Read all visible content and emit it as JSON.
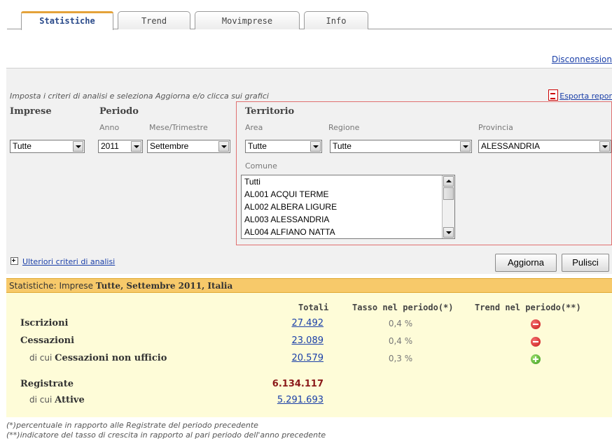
{
  "tabs": [
    {
      "label": "Statistiche",
      "active": true
    },
    {
      "label": "Trend",
      "active": false
    },
    {
      "label": "Movimprese",
      "active": false
    },
    {
      "label": "Info",
      "active": false
    }
  ],
  "top": {
    "disconnect": "Disconnession"
  },
  "criteria": {
    "hint": "Imposta i criteri di analisi e seleziona Aggiorna e/o clicca sui grafici",
    "export": "Esporta repor",
    "imprese": {
      "label": "Imprese",
      "value": "Tutte"
    },
    "periodo": {
      "label": "Periodo",
      "anno_label": "Anno",
      "anno_value": "2011",
      "mese_label": "Mese/Trimestre",
      "mese_value": "Settembre"
    },
    "territorio": {
      "label": "Territorio",
      "area_label": "Area",
      "area_value": "Tutte",
      "regione_label": "Regione",
      "regione_value": "Tutte",
      "provincia_label": "Provincia",
      "provincia_value": "ALESSANDRIA",
      "comune_label": "Comune",
      "comuni": [
        "Tutti",
        "AL001 ACQUI TERME",
        "AL002 ALBERA LIGURE",
        "AL003 ALESSANDRIA",
        "AL004 ALFIANO NATTA"
      ]
    },
    "more": "Ulteriori criteri di analisi",
    "aggiorna": "Aggiorna",
    "pulisci": "Pulisci"
  },
  "stats": {
    "header_prefix": "Statistiche: Imprese ",
    "header_bold": "Tutte, Settembre 2011, Italia",
    "col_totali": "Totali",
    "col_tasso": "Tasso nel periodo(*)",
    "col_trend": "Trend nel periodo(**)",
    "rows": [
      {
        "label": "Iscrizioni",
        "total": "27.492",
        "rate": "0,4 %",
        "trend": "down"
      },
      {
        "label": "Cessazioni",
        "total": "23.089",
        "rate": "0,4 %",
        "trend": "down"
      },
      {
        "prefix": "di cui ",
        "label": "Cessazioni non ufficio",
        "total": "20.579",
        "rate": "0,3 %",
        "trend": "up"
      }
    ],
    "registrate": {
      "label": "Registrate",
      "total": "6.134.117"
    },
    "attive": {
      "prefix": "di cui ",
      "label": "Attive",
      "total": "5.291.693"
    },
    "note1": "(*)percentuale in rapporto alle Registrate del periodo precedente",
    "note2": "(**)indicatore del tasso di crescita in rapporto al pari periodo dell'anno precedente"
  },
  "colors": {
    "tab_accent": "#e4a23a",
    "header_bar": "#f7c96a",
    "body_bg": "#fefcd8",
    "territory_border": "#e07070",
    "link": "#1a3fa8",
    "registrate": "#8b1a1a"
  }
}
